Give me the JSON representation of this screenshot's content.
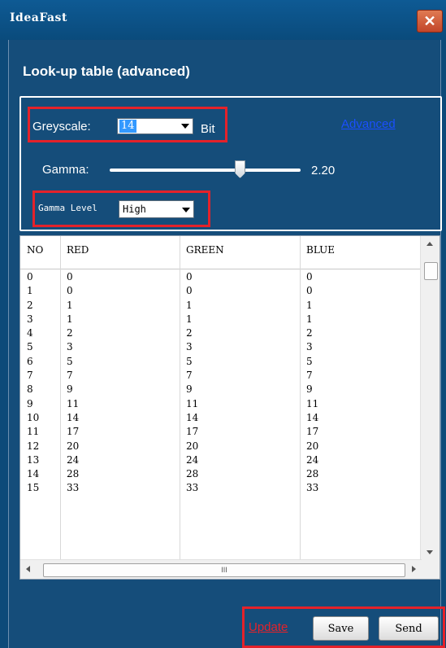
{
  "window": {
    "title": "IdeaFast",
    "close_glyph": "✕"
  },
  "heading": "Look-up table (advanced)",
  "greyscale": {
    "label": "Greyscale:",
    "value": "14",
    "unit": "Bit"
  },
  "advanced_link": "Advanced",
  "gamma": {
    "label": "Gamma:",
    "value": "2.20",
    "slider_fraction": 0.69
  },
  "gamma_level": {
    "label": "Gamma Level",
    "value": "High"
  },
  "table": {
    "columns": [
      "NO",
      "RED",
      "GREEN",
      "BLUE"
    ],
    "rows": [
      [
        "0",
        "0",
        "0",
        "0"
      ],
      [
        "1",
        "0",
        "0",
        "0"
      ],
      [
        "2",
        "1",
        "1",
        "1"
      ],
      [
        "3",
        "1",
        "1",
        "1"
      ],
      [
        "4",
        "2",
        "2",
        "2"
      ],
      [
        "5",
        "3",
        "3",
        "3"
      ],
      [
        "6",
        "5",
        "5",
        "5"
      ],
      [
        "7",
        "7",
        "7",
        "7"
      ],
      [
        "8",
        "9",
        "9",
        "9"
      ],
      [
        "9",
        "11",
        "11",
        "11"
      ],
      [
        "10",
        "14",
        "14",
        "14"
      ],
      [
        "11",
        "17",
        "17",
        "17"
      ],
      [
        "12",
        "20",
        "20",
        "20"
      ],
      [
        "13",
        "24",
        "24",
        "24"
      ],
      [
        "14",
        "28",
        "28",
        "28"
      ],
      [
        "15",
        "33",
        "33",
        "33"
      ]
    ],
    "hscroll_grip": "III"
  },
  "footer": {
    "update_link": "Update",
    "save_label": "Save",
    "send_label": "Send"
  },
  "colors": {
    "accent": "#0d4a79",
    "highlight": "#e4222a",
    "link": "#1a4fff"
  }
}
